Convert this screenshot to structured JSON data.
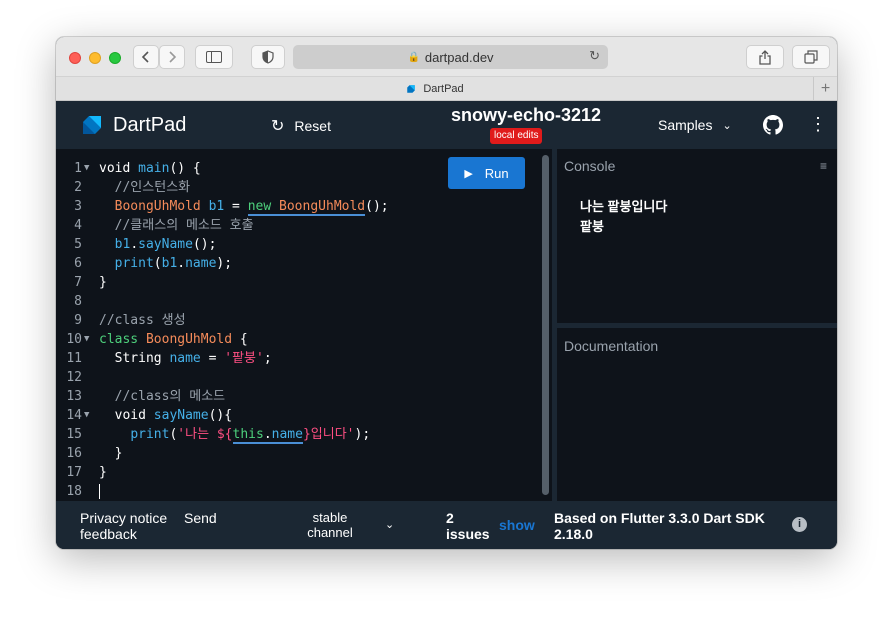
{
  "browser": {
    "url": "dartpad.dev",
    "tab_title": "DartPad",
    "new_tab_label": "+"
  },
  "header": {
    "app_name": "DartPad",
    "reset_label": "Reset",
    "pad_name": "snowy-echo-3212",
    "badge": "local edits",
    "samples_label": "Samples"
  },
  "editor": {
    "run_label": "Run",
    "line_numbers": [
      "1",
      "2",
      "3",
      "4",
      "5",
      "6",
      "7",
      "8",
      "9",
      "10",
      "11",
      "12",
      "13",
      "14",
      "15",
      "16",
      "17",
      "18"
    ],
    "code": {
      "l1_void": "void",
      "l1_main": "main",
      "l1_rest": "() {",
      "l2": "//인스턴스화",
      "l3_type": "BoongUhMold",
      "l3_var": "b1",
      "l3_eq": " = ",
      "l3_new": "new",
      "l3_ctor": "BoongUhMold",
      "l3_end": "();",
      "l4": "//클래스의 메소드 호출",
      "l5_obj": "b1",
      "l5_dot": ".",
      "l5_method": "sayName",
      "l5_end": "();",
      "l6_print": "print",
      "l6_open": "(",
      "l6_obj": "b1",
      "l6_dot": ".",
      "l6_prop": "name",
      "l6_end": ");",
      "l7": "}",
      "l9": "//class 생성",
      "l10_class": "class",
      "l10_name": "BoongUhMold",
      "l10_brace": " {",
      "l11_type": "String",
      "l11_name": "name",
      "l11_eq": " = ",
      "l11_str": "'팥붕'",
      "l11_end": ";",
      "l13": "//class의 메소드",
      "l14_void": "void",
      "l14_name": "sayName",
      "l14_end": "(){",
      "l15_print": "print",
      "l15_open": "(",
      "l15_str_a": "'나는 ${",
      "l15_this": "this",
      "l15_dot": ".",
      "l15_name": "name",
      "l15_str_b": "}입니다'",
      "l15_end": ");",
      "l16": "}",
      "l17": "}"
    }
  },
  "console": {
    "title": "Console",
    "output": [
      "나는 팥붕입니다",
      "팥붕"
    ]
  },
  "documentation": {
    "title": "Documentation"
  },
  "footer": {
    "privacy": "Privacy notice",
    "send": "Send",
    "feedback": "feedback",
    "channel": "stable channel",
    "issues_count": "2",
    "issues_label": "issues",
    "show": "show",
    "sdk": "Based on Flutter 3.3.0 Dart SDK 2.18.0",
    "info_glyph": "i"
  },
  "colors": {
    "header_bg": "#1b2733",
    "editor_bg": "#0e131a",
    "run_button": "#1976d2",
    "badge": "#e01b1b",
    "comment": "#9aa3ad",
    "type": "#f58b5a",
    "identifier": "#45b0e8",
    "keyword_new": "#4dd07c",
    "string": "#ff4f83"
  },
  "icons": {
    "reset": "refresh-icon",
    "run": "play-icon",
    "github": "github-icon",
    "more": "more-vert-icon",
    "console_clear": "clear-console-icon",
    "info": "info-icon"
  }
}
